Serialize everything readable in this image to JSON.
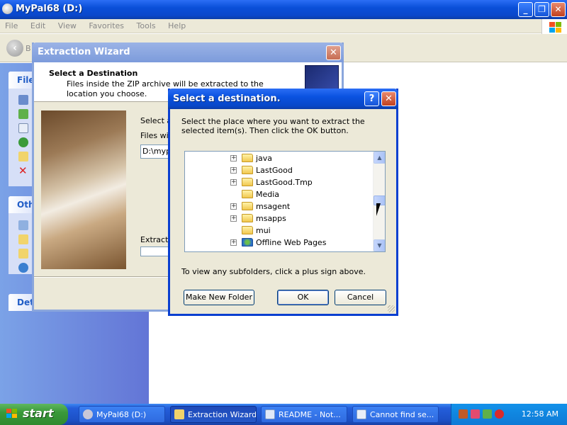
{
  "explorer": {
    "title": "MyPal68 (D:)",
    "menu": [
      "File",
      "Edit",
      "View",
      "Favorites",
      "Tools",
      "Help"
    ],
    "back_label": "B",
    "panels": [
      "File",
      "Oth",
      "Det"
    ]
  },
  "wizard": {
    "title": "Extraction Wizard",
    "header_title": "Select a Destination",
    "header_desc": "Files inside the ZIP archive will be extracted to the location you choose.",
    "label_select": "Select a",
    "label_files": "Files will",
    "path_value": "D:\\mypa",
    "label_extracting": "Extractin"
  },
  "dialog": {
    "title": "Select a destination.",
    "instructions": "Select the place where you want to extract the selected item(s).  Then click the OK button.",
    "hint": "To view any subfolders, click a plus sign above.",
    "tree": [
      {
        "label": "java",
        "expandable": true
      },
      {
        "label": "LastGood",
        "expandable": true
      },
      {
        "label": "LastGood.Tmp",
        "expandable": true
      },
      {
        "label": "Media",
        "expandable": false
      },
      {
        "label": "msagent",
        "expandable": true
      },
      {
        "label": "msapps",
        "expandable": true
      },
      {
        "label": "mui",
        "expandable": false
      },
      {
        "label": "Offline Web Pages",
        "expandable": true
      }
    ],
    "btn_new_folder": "Make New Folder",
    "btn_ok": "OK",
    "btn_cancel": "Cancel"
  },
  "taskbar": {
    "start": "start",
    "items": [
      "MyPal68 (D:)",
      "Extraction Wizard",
      "README - Not...",
      "Cannot find se..."
    ],
    "clock": "12:58 AM"
  },
  "colors": {
    "xp_blue": "#0a52e0",
    "start_green": "#3a993a",
    "task_pane": "#7ba2e7"
  }
}
